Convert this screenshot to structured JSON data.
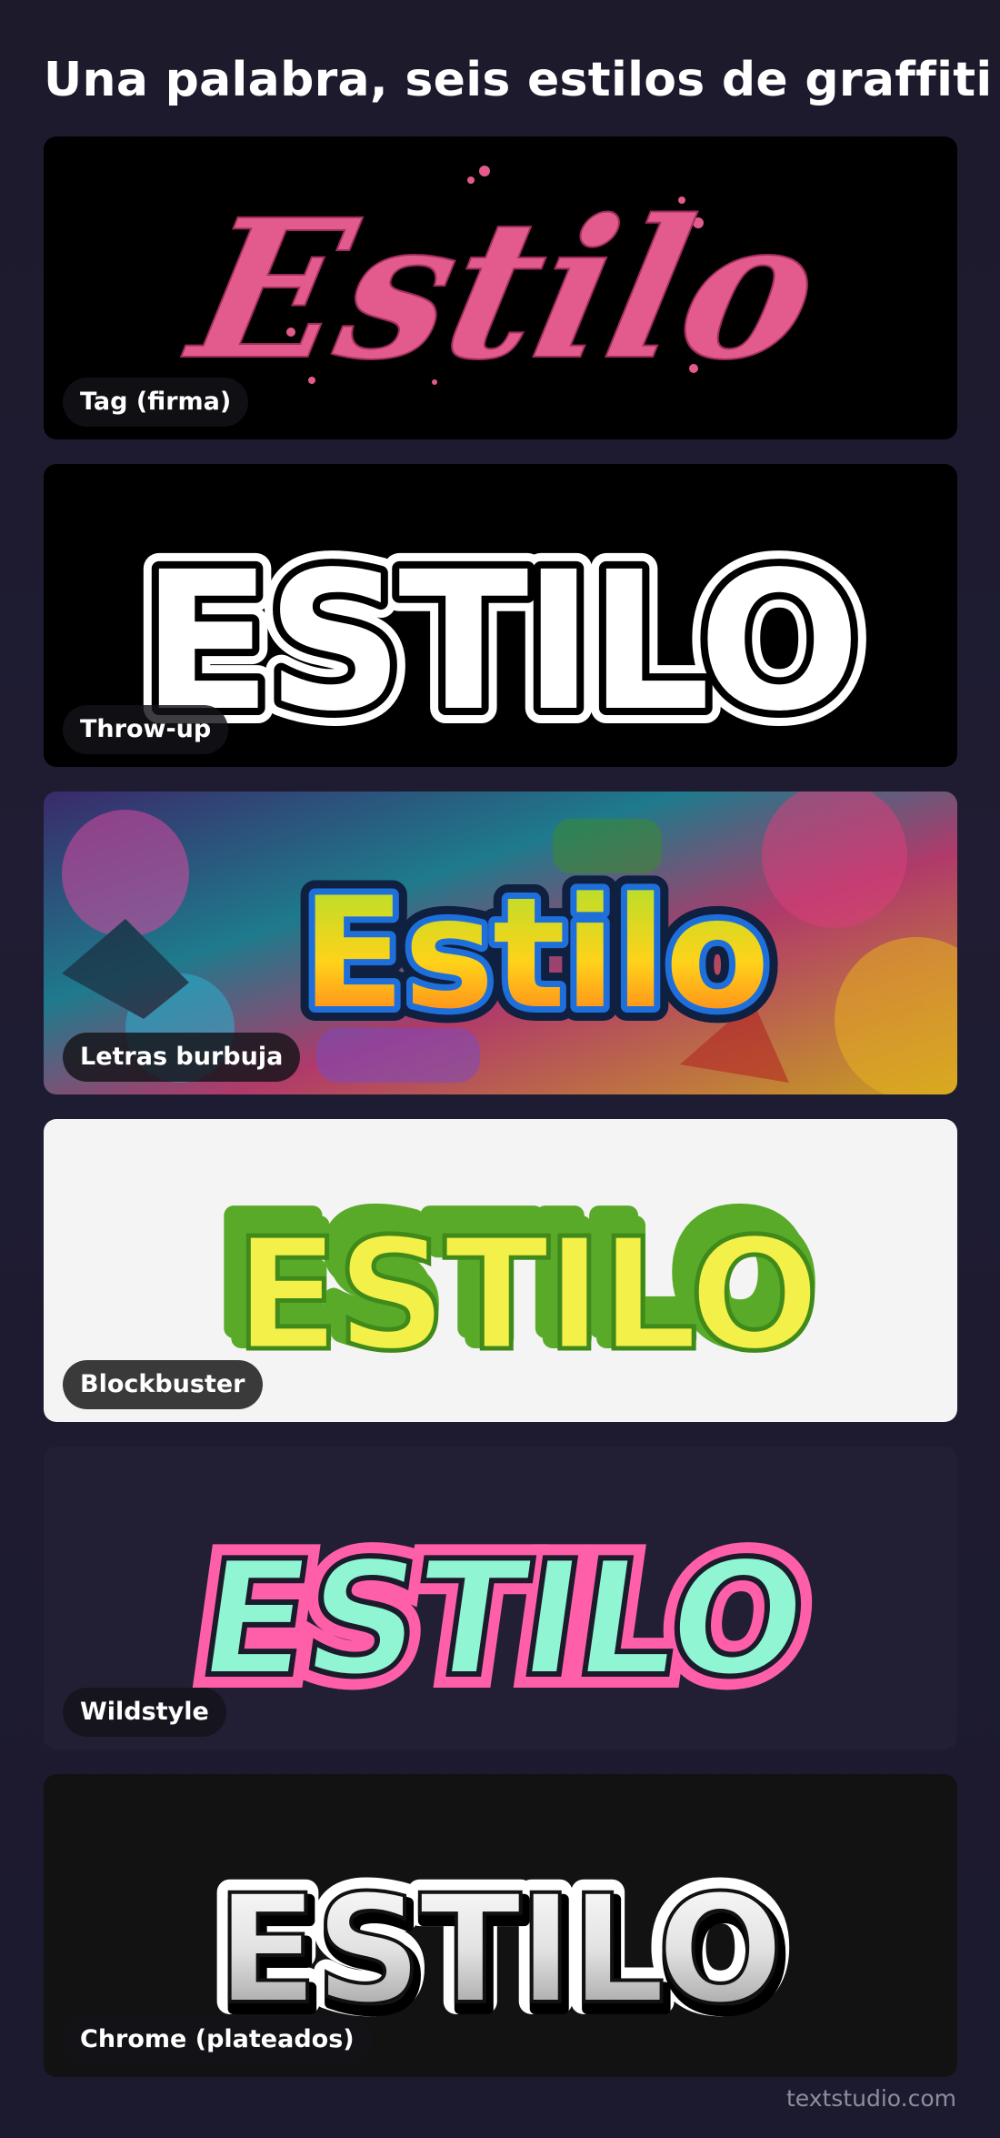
{
  "page": {
    "title": "Una palabra, seis estilos de graffiti"
  },
  "word": "Estilo",
  "word_caps": "ESTILO",
  "cards": [
    {
      "label": "Tag (firma)",
      "style": "tag",
      "background": "#000000",
      "fill": "#e35a8c"
    },
    {
      "label": "Throw-up",
      "style": "throw-up",
      "background": "#000000",
      "fill": "#ffffff",
      "outline": "#000000"
    },
    {
      "label": "Letras burbuja",
      "style": "bubble",
      "background": "graffiti-wall",
      "fill_top": "#a6e22e",
      "fill_bottom": "#ff6b1a",
      "outline": "#1e6fd9"
    },
    {
      "label": "Blockbuster",
      "style": "blockbuster",
      "background": "#f4f4f4",
      "fill": "#f4f04a",
      "extrude": "#5aaa2a"
    },
    {
      "label": "Wildstyle",
      "style": "wildstyle",
      "background": "#201d33",
      "fill": "#8ff5d2",
      "outline": "#ff5fa9"
    },
    {
      "label": "Chrome (plateados)",
      "style": "chrome",
      "background": "#121212",
      "fill_top": "#ffffff",
      "fill_bottom": "#9a9a9a"
    }
  ],
  "footer": {
    "brand": "textstudio.com"
  }
}
